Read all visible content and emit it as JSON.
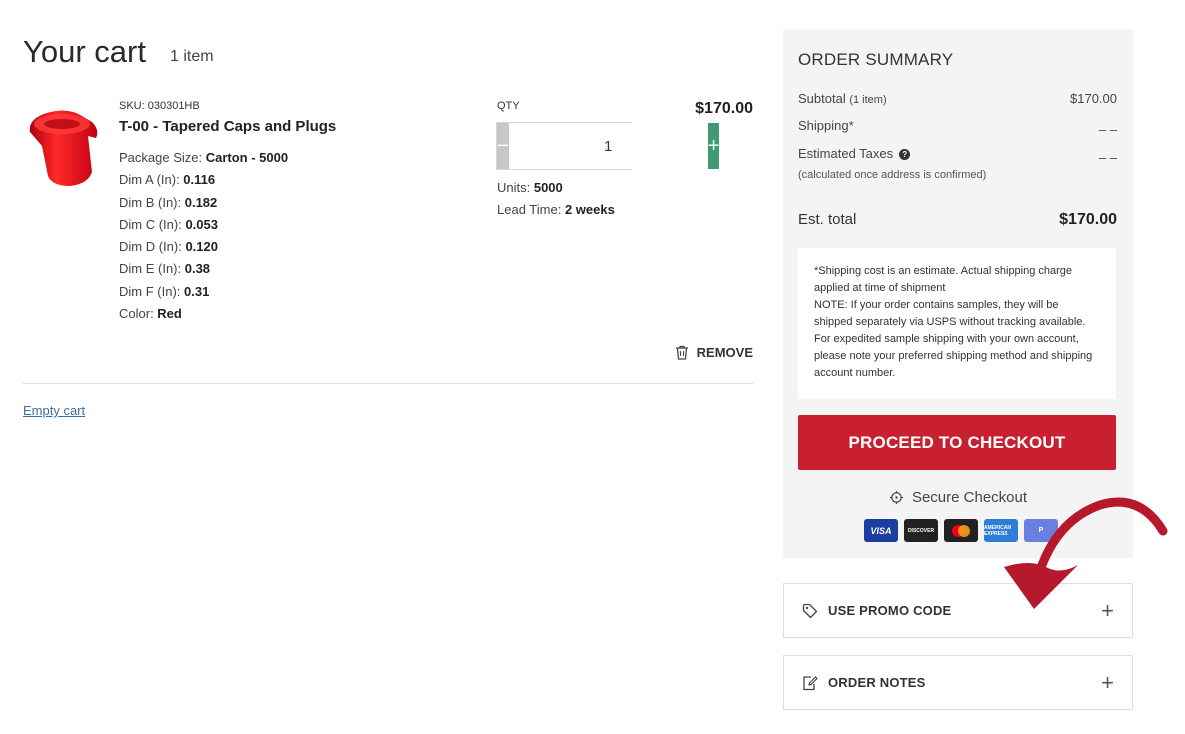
{
  "cart": {
    "title": "Your cart",
    "count": "1 item",
    "empty_label": "Empty cart"
  },
  "item": {
    "sku": "SKU: 030301HB",
    "name": "T-00 - Tapered Caps and Plugs",
    "image_icon": "red-tapered-cap-image",
    "attributes": [
      {
        "label": "Package Size: ",
        "value": "Carton - 5000"
      },
      {
        "label": "Dim A (In): ",
        "value": "0.116"
      },
      {
        "label": "Dim B (In): ",
        "value": "0.182"
      },
      {
        "label": "Dim C (In): ",
        "value": "0.053"
      },
      {
        "label": "Dim D (In): ",
        "value": "0.120"
      },
      {
        "label": "Dim E (In): ",
        "value": "0.38"
      },
      {
        "label": "Dim F (In): ",
        "value": "0.31"
      },
      {
        "label": "Color: ",
        "value": "Red"
      }
    ],
    "qty_label": "QTY",
    "qty_value": "1",
    "minus": "−",
    "plus": "+",
    "units_label": "Units: ",
    "units_value": "5000",
    "lead_label": "Lead Time: ",
    "lead_value": "2 weeks",
    "price": "$170.00",
    "remove_label": "REMOVE"
  },
  "summary": {
    "title": "ORDER SUMMARY",
    "subtotal_label": "Subtotal",
    "subtotal_count": "(1 item)",
    "subtotal_value": "$170.00",
    "shipping_label": "Shipping*",
    "shipping_value": "– –",
    "taxes_label": "Estimated Taxes",
    "taxes_value": "– –",
    "taxes_note": "(calculated once address is confirmed)",
    "total_label": "Est. total",
    "total_value": "$170.00",
    "shipping_note_1": "*Shipping cost is an estimate. Actual shipping charge applied at time of shipment",
    "shipping_note_2": "NOTE: If your order contains samples, they will be shipped separately via USPS without tracking available. For expedited sample shipping with your own account, please note your preferred shipping method and shipping account number.",
    "checkout_label": "PROCEED TO CHECKOUT",
    "secure_label": "Secure Checkout",
    "cards": {
      "visa": "VISA",
      "discover": "DISCOVER",
      "amex": "AMERICAN EXPRESS",
      "other": "P"
    }
  },
  "accordions": {
    "promo_label": "USE PROMO CODE",
    "notes_label": "ORDER NOTES",
    "plus": "+"
  },
  "colors": {
    "checkout": "#c8202e",
    "qty_plus": "#3d9a73",
    "arrow": "#b5192b"
  }
}
